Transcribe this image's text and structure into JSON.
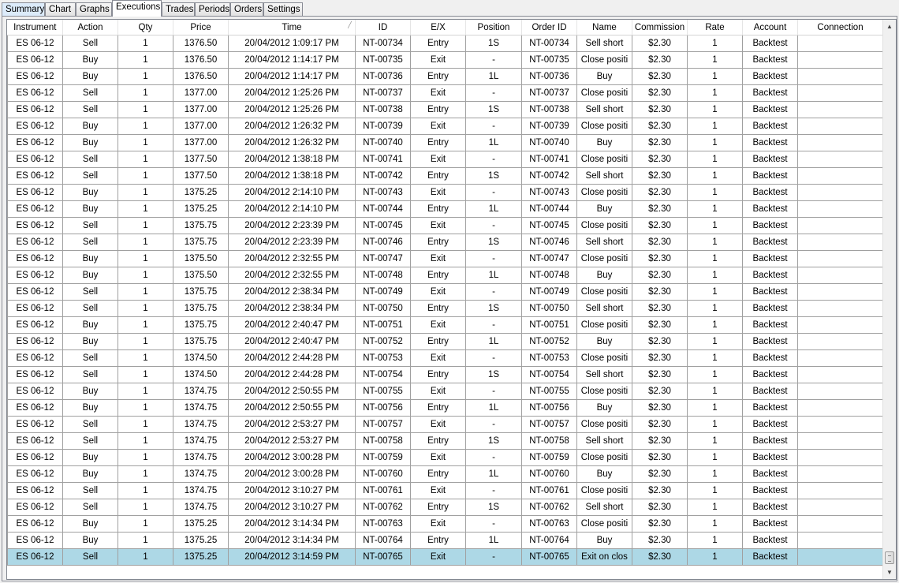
{
  "tabs": [
    {
      "label": "Summary",
      "active": false
    },
    {
      "label": "Chart",
      "active": false
    },
    {
      "label": "Graphs",
      "active": false
    },
    {
      "label": "Executions",
      "active": true
    },
    {
      "label": "Trades",
      "active": false
    },
    {
      "label": "Periods",
      "active": false
    },
    {
      "label": "Orders",
      "active": false
    },
    {
      "label": "Settings",
      "active": false
    }
  ],
  "table": {
    "columns": [
      "Instrument",
      "Action",
      "Qty",
      "Price",
      "Time",
      "ID",
      "E/X",
      "Position",
      "Order ID",
      "Name",
      "Commission",
      "Rate",
      "Account",
      "Connection"
    ],
    "sorted_column": "Time",
    "selected_row_index": 31,
    "rows": [
      [
        "ES 06-12",
        "Sell",
        "1",
        "1376.50",
        "20/04/2012 1:09:17 PM",
        "NT-00734",
        "Entry",
        "1S",
        "NT-00734",
        "Sell short",
        "$2.30",
        "1",
        "Backtest",
        ""
      ],
      [
        "ES 06-12",
        "Buy",
        "1",
        "1376.50",
        "20/04/2012 1:14:17 PM",
        "NT-00735",
        "Exit",
        "-",
        "NT-00735",
        "Close positi",
        "$2.30",
        "1",
        "Backtest",
        ""
      ],
      [
        "ES 06-12",
        "Buy",
        "1",
        "1376.50",
        "20/04/2012 1:14:17 PM",
        "NT-00736",
        "Entry",
        "1L",
        "NT-00736",
        "Buy",
        "$2.30",
        "1",
        "Backtest",
        ""
      ],
      [
        "ES 06-12",
        "Sell",
        "1",
        "1377.00",
        "20/04/2012 1:25:26 PM",
        "NT-00737",
        "Exit",
        "-",
        "NT-00737",
        "Close positi",
        "$2.30",
        "1",
        "Backtest",
        ""
      ],
      [
        "ES 06-12",
        "Sell",
        "1",
        "1377.00",
        "20/04/2012 1:25:26 PM",
        "NT-00738",
        "Entry",
        "1S",
        "NT-00738",
        "Sell short",
        "$2.30",
        "1",
        "Backtest",
        ""
      ],
      [
        "ES 06-12",
        "Buy",
        "1",
        "1377.00",
        "20/04/2012 1:26:32 PM",
        "NT-00739",
        "Exit",
        "-",
        "NT-00739",
        "Close positi",
        "$2.30",
        "1",
        "Backtest",
        ""
      ],
      [
        "ES 06-12",
        "Buy",
        "1",
        "1377.00",
        "20/04/2012 1:26:32 PM",
        "NT-00740",
        "Entry",
        "1L",
        "NT-00740",
        "Buy",
        "$2.30",
        "1",
        "Backtest",
        ""
      ],
      [
        "ES 06-12",
        "Sell",
        "1",
        "1377.50",
        "20/04/2012 1:38:18 PM",
        "NT-00741",
        "Exit",
        "-",
        "NT-00741",
        "Close positi",
        "$2.30",
        "1",
        "Backtest",
        ""
      ],
      [
        "ES 06-12",
        "Sell",
        "1",
        "1377.50",
        "20/04/2012 1:38:18 PM",
        "NT-00742",
        "Entry",
        "1S",
        "NT-00742",
        "Sell short",
        "$2.30",
        "1",
        "Backtest",
        ""
      ],
      [
        "ES 06-12",
        "Buy",
        "1",
        "1375.25",
        "20/04/2012 2:14:10 PM",
        "NT-00743",
        "Exit",
        "-",
        "NT-00743",
        "Close positi",
        "$2.30",
        "1",
        "Backtest",
        ""
      ],
      [
        "ES 06-12",
        "Buy",
        "1",
        "1375.25",
        "20/04/2012 2:14:10 PM",
        "NT-00744",
        "Entry",
        "1L",
        "NT-00744",
        "Buy",
        "$2.30",
        "1",
        "Backtest",
        ""
      ],
      [
        "ES 06-12",
        "Sell",
        "1",
        "1375.75",
        "20/04/2012 2:23:39 PM",
        "NT-00745",
        "Exit",
        "-",
        "NT-00745",
        "Close positi",
        "$2.30",
        "1",
        "Backtest",
        ""
      ],
      [
        "ES 06-12",
        "Sell",
        "1",
        "1375.75",
        "20/04/2012 2:23:39 PM",
        "NT-00746",
        "Entry",
        "1S",
        "NT-00746",
        "Sell short",
        "$2.30",
        "1",
        "Backtest",
        ""
      ],
      [
        "ES 06-12",
        "Buy",
        "1",
        "1375.50",
        "20/04/2012 2:32:55 PM",
        "NT-00747",
        "Exit",
        "-",
        "NT-00747",
        "Close positi",
        "$2.30",
        "1",
        "Backtest",
        ""
      ],
      [
        "ES 06-12",
        "Buy",
        "1",
        "1375.50",
        "20/04/2012 2:32:55 PM",
        "NT-00748",
        "Entry",
        "1L",
        "NT-00748",
        "Buy",
        "$2.30",
        "1",
        "Backtest",
        ""
      ],
      [
        "ES 06-12",
        "Sell",
        "1",
        "1375.75",
        "20/04/2012 2:38:34 PM",
        "NT-00749",
        "Exit",
        "-",
        "NT-00749",
        "Close positi",
        "$2.30",
        "1",
        "Backtest",
        ""
      ],
      [
        "ES 06-12",
        "Sell",
        "1",
        "1375.75",
        "20/04/2012 2:38:34 PM",
        "NT-00750",
        "Entry",
        "1S",
        "NT-00750",
        "Sell short",
        "$2.30",
        "1",
        "Backtest",
        ""
      ],
      [
        "ES 06-12",
        "Buy",
        "1",
        "1375.75",
        "20/04/2012 2:40:47 PM",
        "NT-00751",
        "Exit",
        "-",
        "NT-00751",
        "Close positi",
        "$2.30",
        "1",
        "Backtest",
        ""
      ],
      [
        "ES 06-12",
        "Buy",
        "1",
        "1375.75",
        "20/04/2012 2:40:47 PM",
        "NT-00752",
        "Entry",
        "1L",
        "NT-00752",
        "Buy",
        "$2.30",
        "1",
        "Backtest",
        ""
      ],
      [
        "ES 06-12",
        "Sell",
        "1",
        "1374.50",
        "20/04/2012 2:44:28 PM",
        "NT-00753",
        "Exit",
        "-",
        "NT-00753",
        "Close positi",
        "$2.30",
        "1",
        "Backtest",
        ""
      ],
      [
        "ES 06-12",
        "Sell",
        "1",
        "1374.50",
        "20/04/2012 2:44:28 PM",
        "NT-00754",
        "Entry",
        "1S",
        "NT-00754",
        "Sell short",
        "$2.30",
        "1",
        "Backtest",
        ""
      ],
      [
        "ES 06-12",
        "Buy",
        "1",
        "1374.75",
        "20/04/2012 2:50:55 PM",
        "NT-00755",
        "Exit",
        "-",
        "NT-00755",
        "Close positi",
        "$2.30",
        "1",
        "Backtest",
        ""
      ],
      [
        "ES 06-12",
        "Buy",
        "1",
        "1374.75",
        "20/04/2012 2:50:55 PM",
        "NT-00756",
        "Entry",
        "1L",
        "NT-00756",
        "Buy",
        "$2.30",
        "1",
        "Backtest",
        ""
      ],
      [
        "ES 06-12",
        "Sell",
        "1",
        "1374.75",
        "20/04/2012 2:53:27 PM",
        "NT-00757",
        "Exit",
        "-",
        "NT-00757",
        "Close positi",
        "$2.30",
        "1",
        "Backtest",
        ""
      ],
      [
        "ES 06-12",
        "Sell",
        "1",
        "1374.75",
        "20/04/2012 2:53:27 PM",
        "NT-00758",
        "Entry",
        "1S",
        "NT-00758",
        "Sell short",
        "$2.30",
        "1",
        "Backtest",
        ""
      ],
      [
        "ES 06-12",
        "Buy",
        "1",
        "1374.75",
        "20/04/2012 3:00:28 PM",
        "NT-00759",
        "Exit",
        "-",
        "NT-00759",
        "Close positi",
        "$2.30",
        "1",
        "Backtest",
        ""
      ],
      [
        "ES 06-12",
        "Buy",
        "1",
        "1374.75",
        "20/04/2012 3:00:28 PM",
        "NT-00760",
        "Entry",
        "1L",
        "NT-00760",
        "Buy",
        "$2.30",
        "1",
        "Backtest",
        ""
      ],
      [
        "ES 06-12",
        "Sell",
        "1",
        "1374.75",
        "20/04/2012 3:10:27 PM",
        "NT-00761",
        "Exit",
        "-",
        "NT-00761",
        "Close positi",
        "$2.30",
        "1",
        "Backtest",
        ""
      ],
      [
        "ES 06-12",
        "Sell",
        "1",
        "1374.75",
        "20/04/2012 3:10:27 PM",
        "NT-00762",
        "Entry",
        "1S",
        "NT-00762",
        "Sell short",
        "$2.30",
        "1",
        "Backtest",
        ""
      ],
      [
        "ES 06-12",
        "Buy",
        "1",
        "1375.25",
        "20/04/2012 3:14:34 PM",
        "NT-00763",
        "Exit",
        "-",
        "NT-00763",
        "Close positi",
        "$2.30",
        "1",
        "Backtest",
        ""
      ],
      [
        "ES 06-12",
        "Buy",
        "1",
        "1375.25",
        "20/04/2012 3:14:34 PM",
        "NT-00764",
        "Entry",
        "1L",
        "NT-00764",
        "Buy",
        "$2.30",
        "1",
        "Backtest",
        ""
      ],
      [
        "ES 06-12",
        "Sell",
        "1",
        "1375.25",
        "20/04/2012 3:14:59 PM",
        "NT-00765",
        "Exit",
        "-",
        "NT-00765",
        "Exit on clos",
        "$2.30",
        "1",
        "Backtest",
        ""
      ]
    ]
  },
  "icons": {
    "sort_indicator": "sort-ascending-icon",
    "scroll_up": "scroll-up-arrow-icon",
    "scroll_down": "scroll-down-arrow-icon"
  },
  "colors": {
    "selected_row": "#add8e6",
    "active_tab": "#ffffff",
    "first_tab": "#dcebfa"
  }
}
